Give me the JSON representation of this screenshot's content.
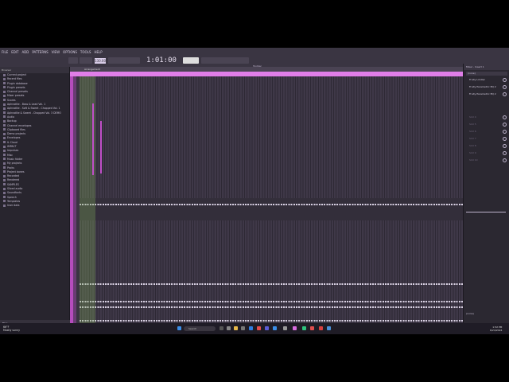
{
  "menu": [
    "FILE",
    "EDIT",
    "ADD",
    "PATTERNS",
    "VIEW",
    "OPTIONS",
    "TOOLS",
    "HELP"
  ],
  "toolbar": {
    "tempo": "130.000",
    "time": "1:01:00",
    "hint": "Toolbar: Amber Beats (track) 1/8 bar by",
    "mini_info": [
      "Toolbar",
      "Consider working CPU on",
      "Plugin available"
    ]
  },
  "browser": {
    "header": "Browser",
    "items": [
      "Current project",
      "Recent files",
      "Plugin database",
      "Plugin presets",
      "Channel presets",
      "Mixer presets",
      "Scores",
      "Aphrodite - Bass & Lead Vol. 1",
      "Aphrodite - Soft & Sweet - Chopped Vol. 1",
      "Aphrodite & Sweet - Chopped Vol. 3 DEMO",
      "Audio",
      "Backup",
      "Channel envelopes",
      "Clipboard files",
      "Demo projects",
      "Envelopes",
      "IL Cloud",
      "IMPACT",
      "Impulses",
      "Misc",
      "Music folder",
      "My projects",
      "Packs",
      "Project bones",
      "Recorded",
      "Rendered",
      "SAMPLES",
      "Sliced audio",
      "Soundfonts",
      "Speech",
      "Templates",
      "User data"
    ],
    "footer": "Files"
  },
  "playlist": {
    "title": "Arrangement"
  },
  "mixer": {
    "title": "Mixer - Insert 1",
    "preset": "(none)",
    "slots": [
      "Fruity Limiter",
      "Fruity Parametric EQ 2",
      "Fruity Parametric EQ 2",
      "Slot 4",
      "Slot 5",
      "Slot 6",
      "Slot 7",
      "Slot 8",
      "Slot 9",
      "Slot 10"
    ],
    "footer": "(none)"
  },
  "taskbar": {
    "weather_temp": "66°F",
    "weather_desc": "Mostly sunny",
    "search": "Search",
    "clock_time": "1:52 PM",
    "clock_date": "6/24/2024"
  },
  "colors": {
    "accent": "#e07ee8",
    "bg": "#2f2b36",
    "panel": "#28252e"
  }
}
